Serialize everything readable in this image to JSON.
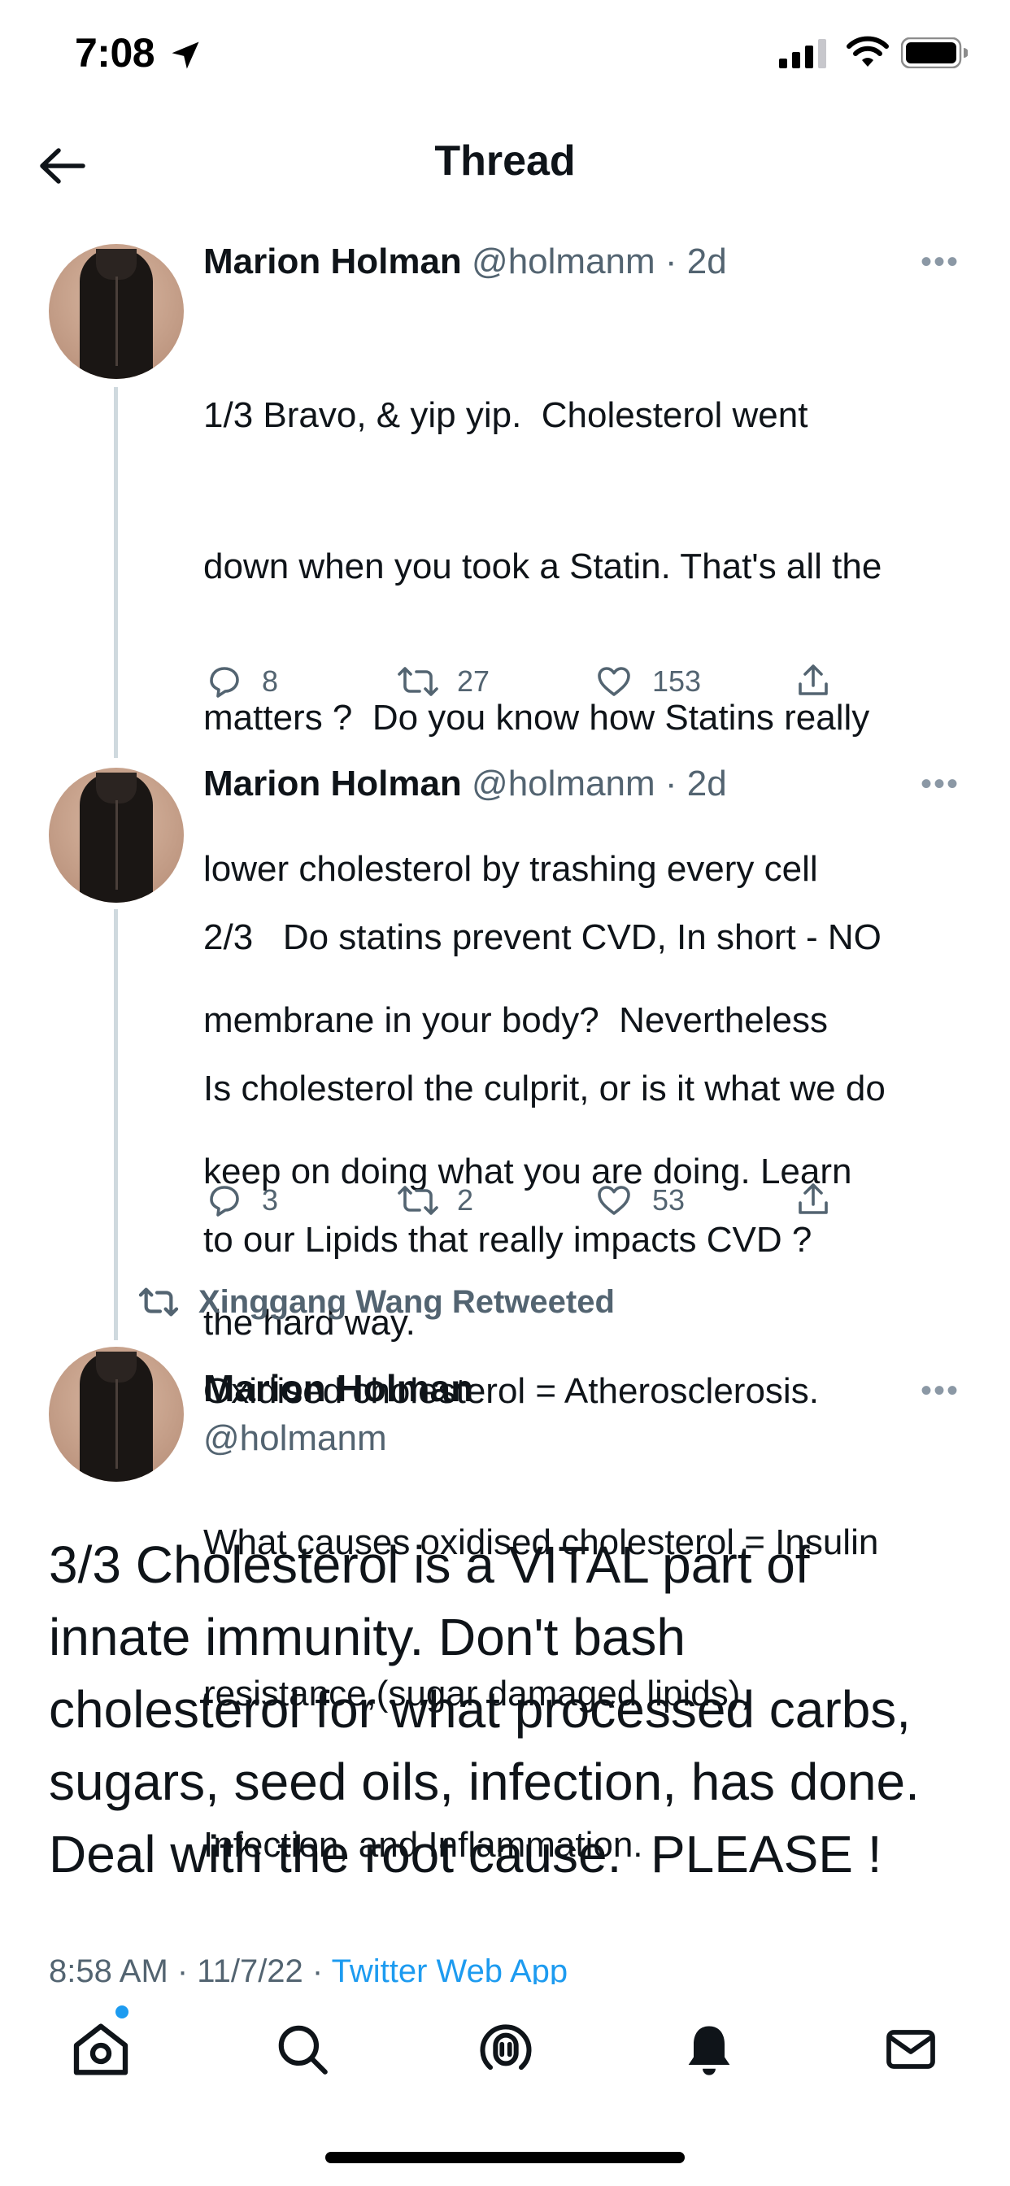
{
  "status_bar": {
    "time": "7:08",
    "icons": [
      "location-arrow-icon",
      "signal-bars-icon",
      "wifi-icon",
      "battery-icon"
    ]
  },
  "header": {
    "title": "Thread",
    "back_icon": "back-arrow-icon"
  },
  "tweets": [
    {
      "name": "Marion Holman",
      "handle": "@holmanm",
      "time": "· 2d",
      "text_lines": [
        "1/3 Bravo, & yip yip.  Cholesterol went",
        "down when you took a Statin. That's all the",
        "matters ?  Do you know how Statins really",
        "lower cholesterol by trashing every cell",
        "membrane in your body?  Nevertheless",
        "keep on doing what you are doing. Learn",
        "the hard way."
      ],
      "replies": "8",
      "retweets": "27",
      "likes": "153"
    },
    {
      "name": "Marion Holman",
      "handle": "@holmanm",
      "time": "· 2d",
      "text_lines": [
        "2/3   Do statins prevent CVD, In short - NO",
        "Is cholesterol the culprit, or is it what we do",
        "to our Lipids that really impacts CVD ?",
        "Oxidised cholesterol = Atherosclerosis.",
        "What causes oxidised cholesterol = Insulin",
        "resistance,(sugar damaged lipids),",
        "Infection, and Inflammation."
      ],
      "replies": "3",
      "retweets": "2",
      "likes": "53"
    }
  ],
  "main_tweet": {
    "retweeted_by": "Xinggang Wang Retweeted",
    "name": "Marion Holman",
    "handle": "@holmanm",
    "text_lines": [
      "3/3 Cholesterol is a VITAL part of",
      "innate immunity. Don't bash",
      "cholesterol for what processed carbs,",
      "sugars, seed oils, infection, has done.",
      "Deal with the root cause.  PLEASE !"
    ],
    "timestamp": "8:58 AM · 11/7/22 · ",
    "source_app": "Twitter Web App"
  },
  "more_label": "•••",
  "tab_bar": {
    "tabs": [
      "home-icon",
      "search-icon",
      "spaces-icon",
      "notifications-icon",
      "messages-icon"
    ],
    "home_has_notification": true
  },
  "colors": {
    "accent": "#1d9bf0",
    "text_primary": "#0f1419",
    "text_secondary": "#536471",
    "thread_line": "#cfd9de"
  }
}
